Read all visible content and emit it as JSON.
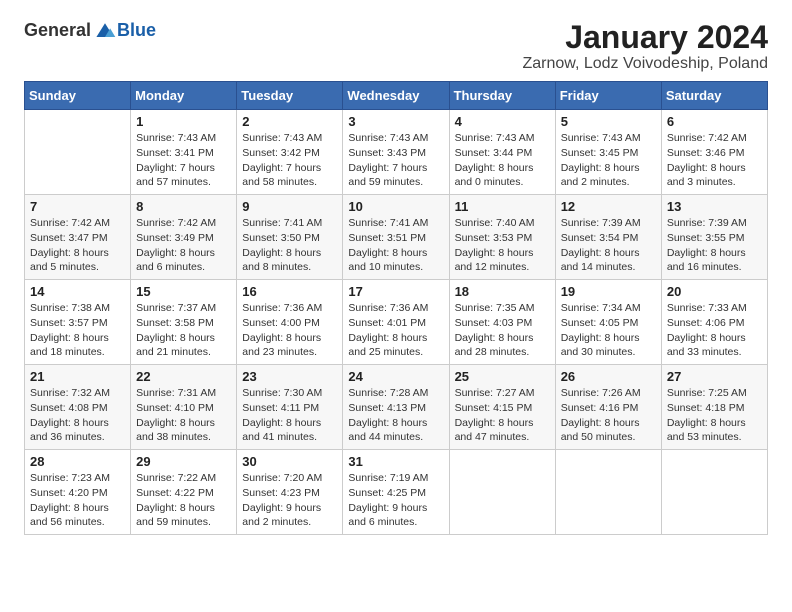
{
  "logo": {
    "text_general": "General",
    "text_blue": "Blue"
  },
  "title": "January 2024",
  "subtitle": "Zarnow, Lodz Voivodeship, Poland",
  "days_of_week": [
    "Sunday",
    "Monday",
    "Tuesday",
    "Wednesday",
    "Thursday",
    "Friday",
    "Saturday"
  ],
  "weeks": [
    [
      {
        "num": "",
        "info": ""
      },
      {
        "num": "1",
        "info": "Sunrise: 7:43 AM\nSunset: 3:41 PM\nDaylight: 7 hours\nand 57 minutes."
      },
      {
        "num": "2",
        "info": "Sunrise: 7:43 AM\nSunset: 3:42 PM\nDaylight: 7 hours\nand 58 minutes."
      },
      {
        "num": "3",
        "info": "Sunrise: 7:43 AM\nSunset: 3:43 PM\nDaylight: 7 hours\nand 59 minutes."
      },
      {
        "num": "4",
        "info": "Sunrise: 7:43 AM\nSunset: 3:44 PM\nDaylight: 8 hours\nand 0 minutes."
      },
      {
        "num": "5",
        "info": "Sunrise: 7:43 AM\nSunset: 3:45 PM\nDaylight: 8 hours\nand 2 minutes."
      },
      {
        "num": "6",
        "info": "Sunrise: 7:42 AM\nSunset: 3:46 PM\nDaylight: 8 hours\nand 3 minutes."
      }
    ],
    [
      {
        "num": "7",
        "info": "Sunrise: 7:42 AM\nSunset: 3:47 PM\nDaylight: 8 hours\nand 5 minutes."
      },
      {
        "num": "8",
        "info": "Sunrise: 7:42 AM\nSunset: 3:49 PM\nDaylight: 8 hours\nand 6 minutes."
      },
      {
        "num": "9",
        "info": "Sunrise: 7:41 AM\nSunset: 3:50 PM\nDaylight: 8 hours\nand 8 minutes."
      },
      {
        "num": "10",
        "info": "Sunrise: 7:41 AM\nSunset: 3:51 PM\nDaylight: 8 hours\nand 10 minutes."
      },
      {
        "num": "11",
        "info": "Sunrise: 7:40 AM\nSunset: 3:53 PM\nDaylight: 8 hours\nand 12 minutes."
      },
      {
        "num": "12",
        "info": "Sunrise: 7:39 AM\nSunset: 3:54 PM\nDaylight: 8 hours\nand 14 minutes."
      },
      {
        "num": "13",
        "info": "Sunrise: 7:39 AM\nSunset: 3:55 PM\nDaylight: 8 hours\nand 16 minutes."
      }
    ],
    [
      {
        "num": "14",
        "info": "Sunrise: 7:38 AM\nSunset: 3:57 PM\nDaylight: 8 hours\nand 18 minutes."
      },
      {
        "num": "15",
        "info": "Sunrise: 7:37 AM\nSunset: 3:58 PM\nDaylight: 8 hours\nand 21 minutes."
      },
      {
        "num": "16",
        "info": "Sunrise: 7:36 AM\nSunset: 4:00 PM\nDaylight: 8 hours\nand 23 minutes."
      },
      {
        "num": "17",
        "info": "Sunrise: 7:36 AM\nSunset: 4:01 PM\nDaylight: 8 hours\nand 25 minutes."
      },
      {
        "num": "18",
        "info": "Sunrise: 7:35 AM\nSunset: 4:03 PM\nDaylight: 8 hours\nand 28 minutes."
      },
      {
        "num": "19",
        "info": "Sunrise: 7:34 AM\nSunset: 4:05 PM\nDaylight: 8 hours\nand 30 minutes."
      },
      {
        "num": "20",
        "info": "Sunrise: 7:33 AM\nSunset: 4:06 PM\nDaylight: 8 hours\nand 33 minutes."
      }
    ],
    [
      {
        "num": "21",
        "info": "Sunrise: 7:32 AM\nSunset: 4:08 PM\nDaylight: 8 hours\nand 36 minutes."
      },
      {
        "num": "22",
        "info": "Sunrise: 7:31 AM\nSunset: 4:10 PM\nDaylight: 8 hours\nand 38 minutes."
      },
      {
        "num": "23",
        "info": "Sunrise: 7:30 AM\nSunset: 4:11 PM\nDaylight: 8 hours\nand 41 minutes."
      },
      {
        "num": "24",
        "info": "Sunrise: 7:28 AM\nSunset: 4:13 PM\nDaylight: 8 hours\nand 44 minutes."
      },
      {
        "num": "25",
        "info": "Sunrise: 7:27 AM\nSunset: 4:15 PM\nDaylight: 8 hours\nand 47 minutes."
      },
      {
        "num": "26",
        "info": "Sunrise: 7:26 AM\nSunset: 4:16 PM\nDaylight: 8 hours\nand 50 minutes."
      },
      {
        "num": "27",
        "info": "Sunrise: 7:25 AM\nSunset: 4:18 PM\nDaylight: 8 hours\nand 53 minutes."
      }
    ],
    [
      {
        "num": "28",
        "info": "Sunrise: 7:23 AM\nSunset: 4:20 PM\nDaylight: 8 hours\nand 56 minutes."
      },
      {
        "num": "29",
        "info": "Sunrise: 7:22 AM\nSunset: 4:22 PM\nDaylight: 8 hours\nand 59 minutes."
      },
      {
        "num": "30",
        "info": "Sunrise: 7:20 AM\nSunset: 4:23 PM\nDaylight: 9 hours\nand 2 minutes."
      },
      {
        "num": "31",
        "info": "Sunrise: 7:19 AM\nSunset: 4:25 PM\nDaylight: 9 hours\nand 6 minutes."
      },
      {
        "num": "",
        "info": ""
      },
      {
        "num": "",
        "info": ""
      },
      {
        "num": "",
        "info": ""
      }
    ]
  ]
}
